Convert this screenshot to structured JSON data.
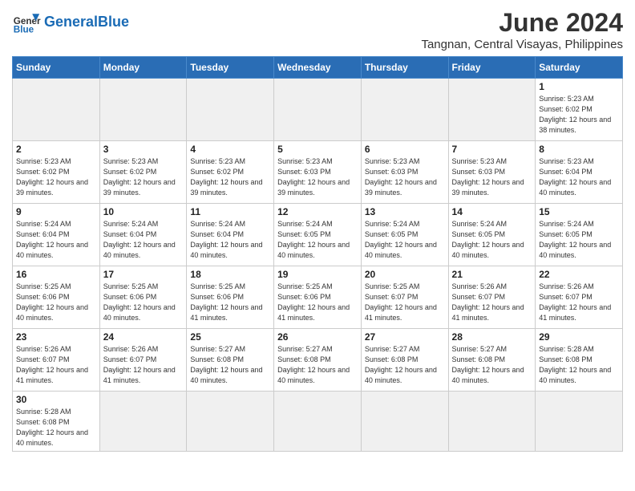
{
  "header": {
    "logo_general": "General",
    "logo_blue": "Blue",
    "month_year": "June 2024",
    "location": "Tangnan, Central Visayas, Philippines"
  },
  "days_of_week": [
    "Sunday",
    "Monday",
    "Tuesday",
    "Wednesday",
    "Thursday",
    "Friday",
    "Saturday"
  ],
  "weeks": [
    [
      {
        "day": "",
        "empty": true
      },
      {
        "day": "",
        "empty": true
      },
      {
        "day": "",
        "empty": true
      },
      {
        "day": "",
        "empty": true
      },
      {
        "day": "",
        "empty": true
      },
      {
        "day": "",
        "empty": true
      },
      {
        "day": "1",
        "sunrise": "5:23 AM",
        "sunset": "6:02 PM",
        "daylight": "12 hours and 38 minutes."
      }
    ],
    [
      {
        "day": "2",
        "sunrise": "5:23 AM",
        "sunset": "6:02 PM",
        "daylight": "12 hours and 39 minutes."
      },
      {
        "day": "3",
        "sunrise": "5:23 AM",
        "sunset": "6:02 PM",
        "daylight": "12 hours and 39 minutes."
      },
      {
        "day": "4",
        "sunrise": "5:23 AM",
        "sunset": "6:02 PM",
        "daylight": "12 hours and 39 minutes."
      },
      {
        "day": "5",
        "sunrise": "5:23 AM",
        "sunset": "6:03 PM",
        "daylight": "12 hours and 39 minutes."
      },
      {
        "day": "6",
        "sunrise": "5:23 AM",
        "sunset": "6:03 PM",
        "daylight": "12 hours and 39 minutes."
      },
      {
        "day": "7",
        "sunrise": "5:23 AM",
        "sunset": "6:03 PM",
        "daylight": "12 hours and 39 minutes."
      },
      {
        "day": "8",
        "sunrise": "5:23 AM",
        "sunset": "6:04 PM",
        "daylight": "12 hours and 40 minutes."
      }
    ],
    [
      {
        "day": "9",
        "sunrise": "5:24 AM",
        "sunset": "6:04 PM",
        "daylight": "12 hours and 40 minutes."
      },
      {
        "day": "10",
        "sunrise": "5:24 AM",
        "sunset": "6:04 PM",
        "daylight": "12 hours and 40 minutes."
      },
      {
        "day": "11",
        "sunrise": "5:24 AM",
        "sunset": "6:04 PM",
        "daylight": "12 hours and 40 minutes."
      },
      {
        "day": "12",
        "sunrise": "5:24 AM",
        "sunset": "6:05 PM",
        "daylight": "12 hours and 40 minutes."
      },
      {
        "day": "13",
        "sunrise": "5:24 AM",
        "sunset": "6:05 PM",
        "daylight": "12 hours and 40 minutes."
      },
      {
        "day": "14",
        "sunrise": "5:24 AM",
        "sunset": "6:05 PM",
        "daylight": "12 hours and 40 minutes."
      },
      {
        "day": "15",
        "sunrise": "5:24 AM",
        "sunset": "6:05 PM",
        "daylight": "12 hours and 40 minutes."
      }
    ],
    [
      {
        "day": "16",
        "sunrise": "5:25 AM",
        "sunset": "6:06 PM",
        "daylight": "12 hours and 40 minutes."
      },
      {
        "day": "17",
        "sunrise": "5:25 AM",
        "sunset": "6:06 PM",
        "daylight": "12 hours and 40 minutes."
      },
      {
        "day": "18",
        "sunrise": "5:25 AM",
        "sunset": "6:06 PM",
        "daylight": "12 hours and 41 minutes."
      },
      {
        "day": "19",
        "sunrise": "5:25 AM",
        "sunset": "6:06 PM",
        "daylight": "12 hours and 41 minutes."
      },
      {
        "day": "20",
        "sunrise": "5:25 AM",
        "sunset": "6:07 PM",
        "daylight": "12 hours and 41 minutes."
      },
      {
        "day": "21",
        "sunrise": "5:26 AM",
        "sunset": "6:07 PM",
        "daylight": "12 hours and 41 minutes."
      },
      {
        "day": "22",
        "sunrise": "5:26 AM",
        "sunset": "6:07 PM",
        "daylight": "12 hours and 41 minutes."
      }
    ],
    [
      {
        "day": "23",
        "sunrise": "5:26 AM",
        "sunset": "6:07 PM",
        "daylight": "12 hours and 41 minutes."
      },
      {
        "day": "24",
        "sunrise": "5:26 AM",
        "sunset": "6:07 PM",
        "daylight": "12 hours and 41 minutes."
      },
      {
        "day": "25",
        "sunrise": "5:27 AM",
        "sunset": "6:08 PM",
        "daylight": "12 hours and 40 minutes."
      },
      {
        "day": "26",
        "sunrise": "5:27 AM",
        "sunset": "6:08 PM",
        "daylight": "12 hours and 40 minutes."
      },
      {
        "day": "27",
        "sunrise": "5:27 AM",
        "sunset": "6:08 PM",
        "daylight": "12 hours and 40 minutes."
      },
      {
        "day": "28",
        "sunrise": "5:27 AM",
        "sunset": "6:08 PM",
        "daylight": "12 hours and 40 minutes."
      },
      {
        "day": "29",
        "sunrise": "5:28 AM",
        "sunset": "6:08 PM",
        "daylight": "12 hours and 40 minutes."
      }
    ],
    [
      {
        "day": "30",
        "sunrise": "5:28 AM",
        "sunset": "6:08 PM",
        "daylight": "12 hours and 40 minutes."
      },
      {
        "day": "",
        "empty": true
      },
      {
        "day": "",
        "empty": true
      },
      {
        "day": "",
        "empty": true
      },
      {
        "day": "",
        "empty": true
      },
      {
        "day": "",
        "empty": true
      },
      {
        "day": "",
        "empty": true
      }
    ]
  ]
}
